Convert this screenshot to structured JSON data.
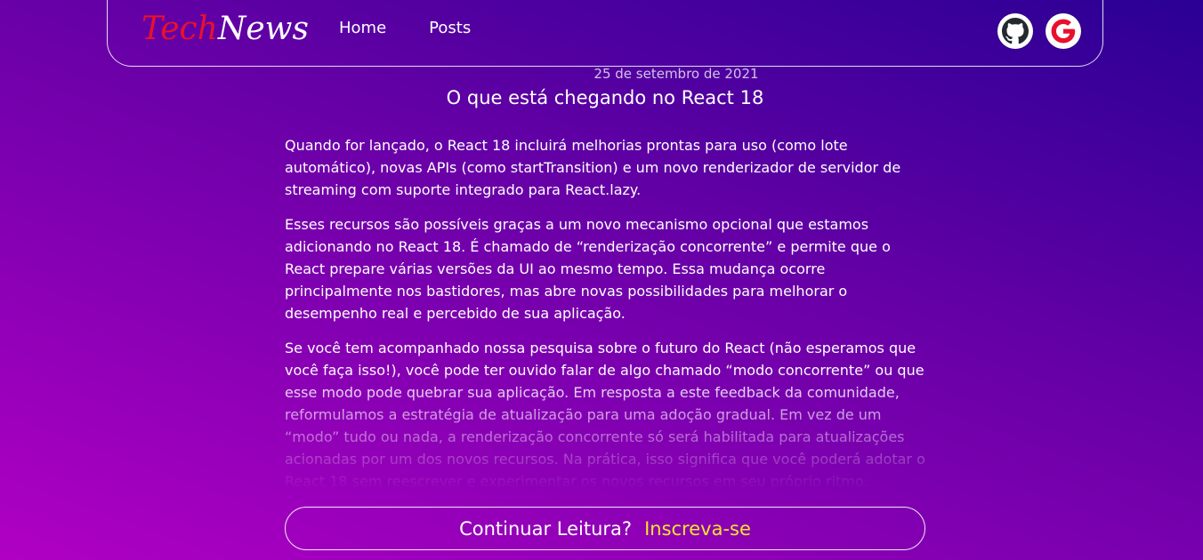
{
  "header": {
    "logo_part1": "Tech",
    "logo_part2": "News",
    "nav": {
      "home": "Home",
      "posts": "Posts"
    },
    "icons": [
      "github-icon",
      "google-icon"
    ]
  },
  "article": {
    "date": "25 de setembro de 2021",
    "title": "O que está chegando no React 18",
    "paragraphs": [
      "Quando for lançado, o React 18 incluirá melhorias prontas para uso (como lote automático), novas APIs (como startTransition) e um novo renderizador de servidor de streaming com suporte integrado para React.lazy.",
      "Esses recursos são possíveis graças a um novo mecanismo opcional que estamos adicionando no React 18. É chamado de “renderização concorrente” e permite que o React prepare várias versões da UI ao mesmo tempo. Essa mudança ocorre principalmente nos bastidores, mas abre novas possibilidades para melhorar o desempenho real e percebido de sua aplicação.",
      "Se você tem acompanhado nossa pesquisa sobre o futuro do React (não esperamos que você faça isso!), você pode ter ouvido falar de algo chamado “modo concorrente” ou que esse modo pode quebrar sua aplicação. Em resposta a este feedback da comunidade, reformulamos a estratégia de atualização para uma adoção gradual. Em vez de um “modo” tudo ou nada, a renderização concorrente só será habilitada para atualizações acionadas por um dos novos recursos. Na prática, isso significa que você poderá adotar o React 18 sem reescrever e experimentar os novos recursos em seu próprio ritmo."
    ]
  },
  "subscribe": {
    "prompt": "Continuar Leitura?",
    "cta": "Inscreva-se"
  },
  "colors": {
    "logo_accent": "#e8112d",
    "cta": "#f4e42c",
    "bg_top": "#2a0094",
    "bg_bottom": "#b000c4"
  }
}
